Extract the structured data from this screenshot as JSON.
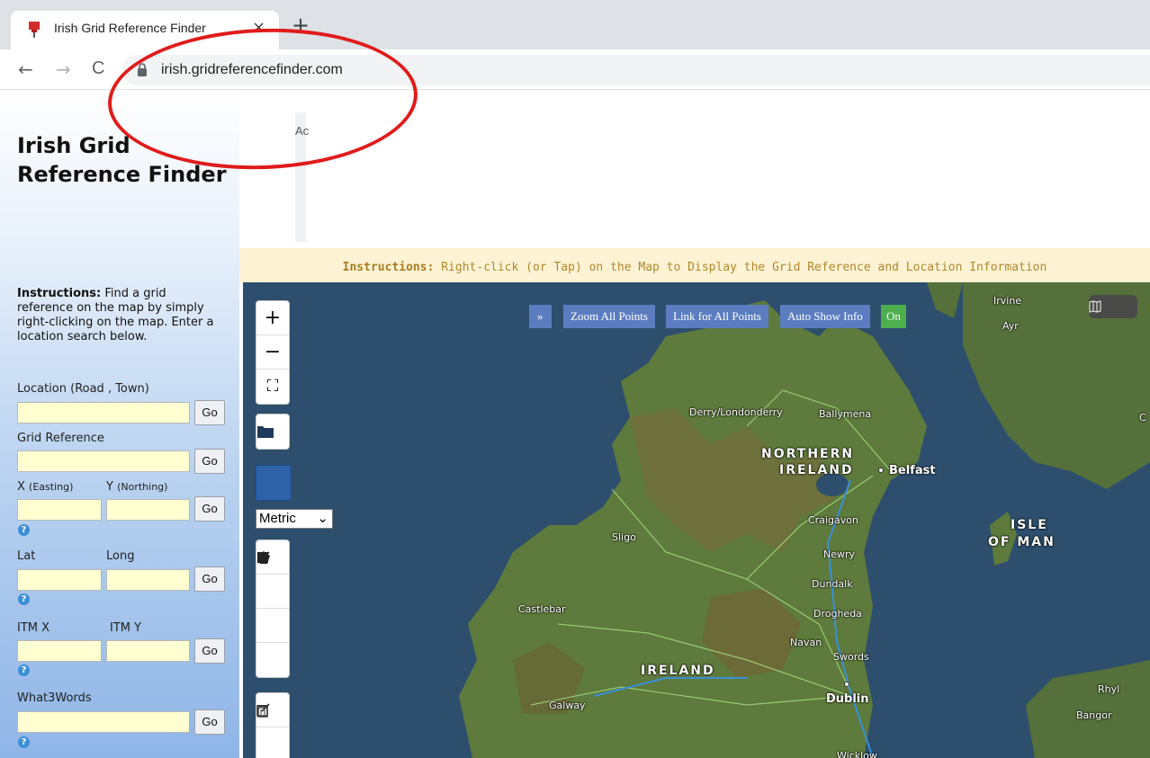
{
  "browser": {
    "tab_title": "Irish Grid Reference Finder",
    "tab_close": "×",
    "new_tab": "+",
    "back": "←",
    "forward": "→",
    "reload": "C",
    "url": "irish.gridreferencefinder.com"
  },
  "site": {
    "title": "Irish Grid Reference Finder",
    "ad_label": "Ac"
  },
  "instructions_bar": {
    "label": "Instructions:",
    "text": " Right-click (or Tap) on the Map to Display the Grid Reference and Location Information"
  },
  "sidebar": {
    "instr_label": "Instructions:",
    "instr_text": " Find a grid reference on the map by simply right-clicking on the map. Enter a location search below.",
    "location_label": "Location (Road , Town)",
    "gridref_label": "Grid Reference",
    "x_label": "X",
    "x_sub": "(Easting)",
    "y_label": "Y",
    "y_sub": "(Northing)",
    "lat_label": "Lat",
    "long_label": "Long",
    "itmx_label": "ITM X",
    "itmy_label": "ITM Y",
    "w3w_label": "What3Words",
    "go": "Go",
    "help": "?"
  },
  "map": {
    "zoom_in": "+",
    "zoom_out": "−",
    "fullscreen": "⛶",
    "unit": "Metric",
    "expand": "»",
    "zoom_all": "Zoom All Points",
    "link_all": "Link for All Points",
    "auto_show": "Auto Show Info",
    "auto_on": "On",
    "places": {
      "irvine": "Irvine",
      "ayr": "Ayr",
      "derry": "Derry/Londonderry",
      "ballymena": "Ballymena",
      "ni_1": "NORTHERN",
      "ni_2": "IRELAND",
      "belfast": "Belfast",
      "craigavon": "Craigavon",
      "sligo": "Sligo",
      "newry": "Newry",
      "isle_1": "ISLE",
      "isle_2": "OF MAN",
      "dundalk": "Dundalk",
      "castlebar": "Castlebar",
      "drogheda": "Drogheda",
      "navan": "Navan",
      "swords": "Swords",
      "ireland": "IRELAND",
      "dublin": "Dublin",
      "galway": "Galway",
      "rhyl": "Rhyl",
      "bangor": "Bangor",
      "wicklow": "Wicklow",
      "edge_c": "C"
    }
  },
  "colors": {
    "annotation": "#e01b1b",
    "input_bg": "#ffffd2",
    "map_button": "#5b7dc0",
    "on_button": "#4cae4c"
  }
}
